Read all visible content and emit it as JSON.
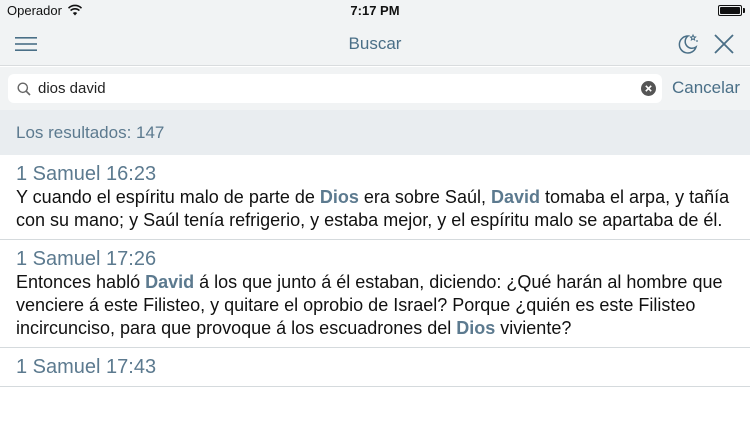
{
  "status_bar": {
    "carrier": "Operador",
    "time": "7:17 PM"
  },
  "nav": {
    "title": "Buscar",
    "icons": {
      "menu": "menu-icon",
      "night": "night-mode-icon",
      "close": "close-icon"
    }
  },
  "search": {
    "value": "dios david",
    "placeholder": "",
    "cancel_label": "Cancelar"
  },
  "results": {
    "count_label": "Los resultados: 147",
    "items": [
      {
        "reference": "1 Samuel 16:23",
        "segments": [
          {
            "text": "Y cuando el espíritu malo de parte de "
          },
          {
            "text": "Dios",
            "highlight": true
          },
          {
            "text": " era sobre Saúl, "
          },
          {
            "text": "David",
            "highlight": true
          },
          {
            "text": " tomaba el arpa, y tañía con su mano; y Saúl tenía refrigerio, y estaba mejor, y el espíritu malo se apartaba de él."
          }
        ]
      },
      {
        "reference": "1 Samuel 17:26",
        "segments": [
          {
            "text": "Entonces habló "
          },
          {
            "text": "David",
            "highlight": true
          },
          {
            "text": " á los que junto á él estaban, diciendo: ¿Qué harán al hombre que venciere á este Filisteo, y quitare el oprobio de Israel? Porque ¿quién es este Filisteo incircunciso, para que provoque á los escuadrones del "
          },
          {
            "text": "Dios",
            "highlight": true
          },
          {
            "text": " viviente?"
          }
        ]
      },
      {
        "reference": "1 Samuel 17:43",
        "segments": []
      }
    ]
  },
  "colors": {
    "accent": "#4a6f87",
    "highlight": "#5c7a8f",
    "bar_bg": "#f1f3f4",
    "results_header_bg": "#e9edf0"
  }
}
